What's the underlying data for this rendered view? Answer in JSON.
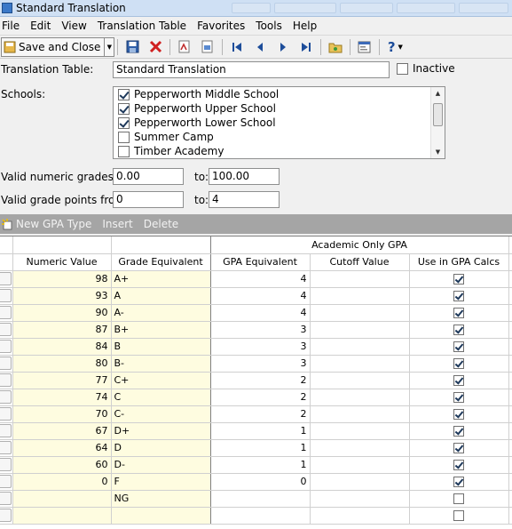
{
  "window": {
    "title": "Standard Translation"
  },
  "menu": [
    "File",
    "Edit",
    "View",
    "Translation Table",
    "Favorites",
    "Tools",
    "Help"
  ],
  "toolbar": {
    "save_close_label": "Save and Close",
    "icons": [
      "save-icon",
      "delete-icon",
      "report-icon",
      "grade-report-icon",
      "first-record-icon",
      "previous-record-icon",
      "next-record-icon",
      "last-record-icon",
      "folder-icon",
      "properties-icon",
      "help-icon"
    ]
  },
  "form": {
    "translation_table_label": "Translation Table:",
    "translation_table_value": "Standard Translation",
    "inactive_label": "Inactive",
    "inactive_checked": false,
    "schools_label": "Schools:",
    "schools": [
      {
        "name": "Pepperworth Middle School",
        "checked": true
      },
      {
        "name": "Pepperworth Upper School",
        "checked": true
      },
      {
        "name": "Pepperworth Lower School",
        "checked": true
      },
      {
        "name": "Summer Camp",
        "checked": false
      },
      {
        "name": "Timber Academy",
        "checked": false
      }
    ],
    "numeric_grades_label": "Valid numeric grades from:",
    "numeric_from": "0.00",
    "to_label": "to:",
    "numeric_to": "100.00",
    "grade_points_label": "Valid grade points from:",
    "points_from": "0",
    "points_to": "4"
  },
  "grid_toolbar": {
    "new_label": "New GPA Type",
    "insert_label": "Insert",
    "delete_label": "Delete"
  },
  "grid": {
    "group_header": "Academic Only GPA",
    "columns": [
      "Numeric Value",
      "Grade Equivalent",
      "GPA Equivalent",
      "Cutoff Value",
      "Use in GPA Calcs"
    ],
    "rows": [
      {
        "numeric": "98",
        "grade": "A+",
        "gpa": "4",
        "cutoff": "",
        "use": true
      },
      {
        "numeric": "93",
        "grade": "A",
        "gpa": "4",
        "cutoff": "",
        "use": true
      },
      {
        "numeric": "90",
        "grade": "A-",
        "gpa": "4",
        "cutoff": "",
        "use": true
      },
      {
        "numeric": "87",
        "grade": "B+",
        "gpa": "3",
        "cutoff": "",
        "use": true
      },
      {
        "numeric": "84",
        "grade": "B",
        "gpa": "3",
        "cutoff": "",
        "use": true
      },
      {
        "numeric": "80",
        "grade": "B-",
        "gpa": "3",
        "cutoff": "",
        "use": true
      },
      {
        "numeric": "77",
        "grade": "C+",
        "gpa": "2",
        "cutoff": "",
        "use": true
      },
      {
        "numeric": "74",
        "grade": "C",
        "gpa": "2",
        "cutoff": "",
        "use": true
      },
      {
        "numeric": "70",
        "grade": "C-",
        "gpa": "2",
        "cutoff": "",
        "use": true
      },
      {
        "numeric": "67",
        "grade": "D+",
        "gpa": "1",
        "cutoff": "",
        "use": true
      },
      {
        "numeric": "64",
        "grade": "D",
        "gpa": "1",
        "cutoff": "",
        "use": true
      },
      {
        "numeric": "60",
        "grade": "D-",
        "gpa": "1",
        "cutoff": "",
        "use": true
      },
      {
        "numeric": "0",
        "grade": "F",
        "gpa": "0",
        "cutoff": "",
        "use": true
      },
      {
        "numeric": "",
        "grade": "NG",
        "gpa": "",
        "cutoff": "",
        "use": false
      },
      {
        "numeric": "",
        "grade": "",
        "gpa": "",
        "cutoff": "",
        "use": false
      }
    ]
  },
  "colors": {
    "grade_column_bg": "#fefce0",
    "grid_toolbar_bg": "#a5a5a5",
    "titlebar_bg": "#cfe0f4"
  }
}
